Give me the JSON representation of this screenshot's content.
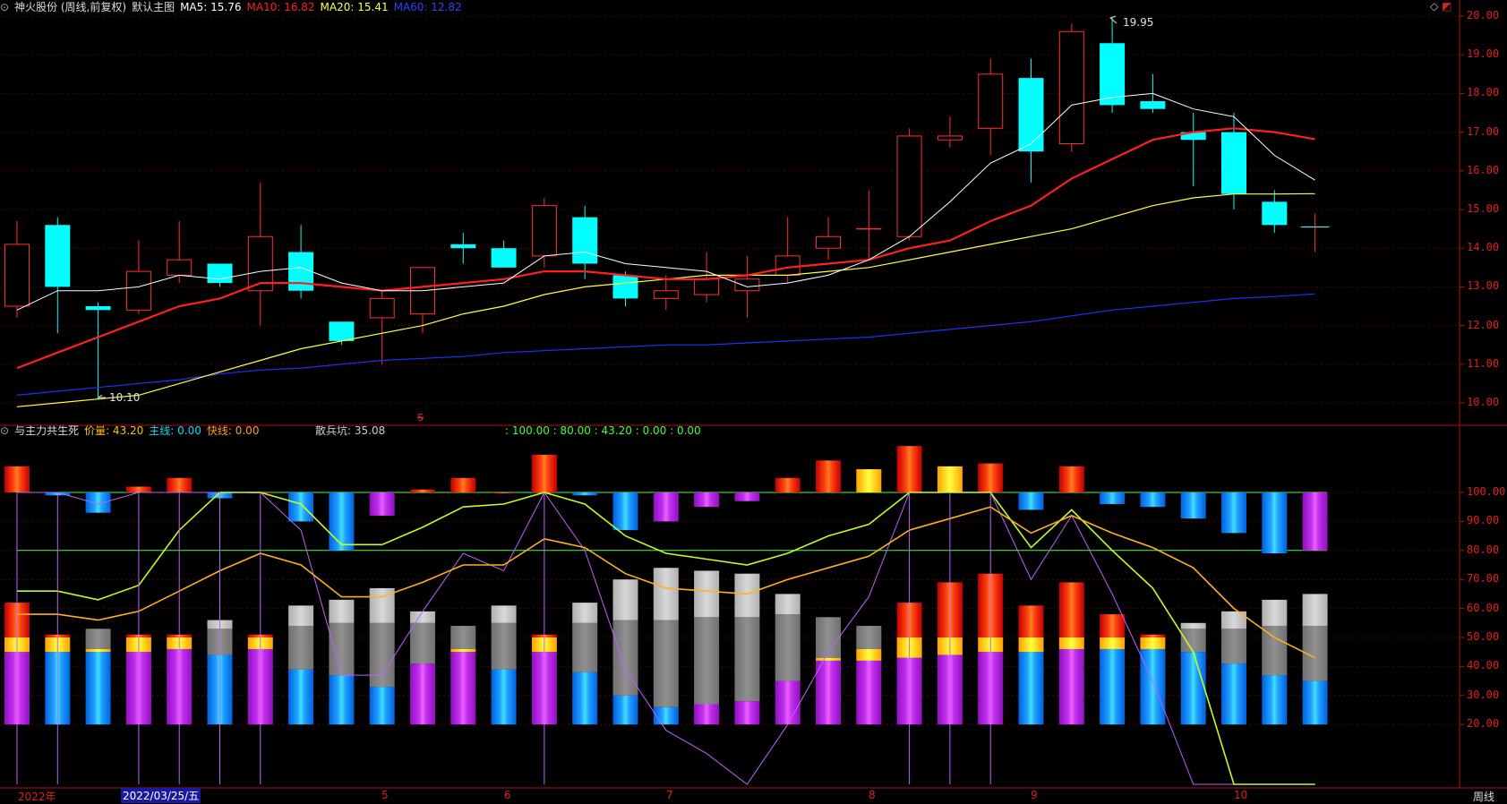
{
  "header": {
    "stock_title": "神火股份 (周线,前复权)",
    "indicator_menu": "默认主图",
    "ma5_label": "MA5: 15.76",
    "ma10_label": "MA10: 16.82",
    "ma20_label": "MA20: 15.41",
    "ma60_label": "MA60: 12.82",
    "ma5_color": "#ffffff",
    "ma10_color": "#ff2020",
    "ma20_color": "#ffff40",
    "ma60_color": "#2030ff"
  },
  "sub_header": {
    "indicator_name": "与主力共生死",
    "jialiang": "价量: 43.20",
    "zhuxian": "主线: 0.00",
    "kuaixian": "快线: 0.00",
    "sanbingkeng": "散兵坑: 35.08",
    "levels_text": ": 100.00 : 80.00 : 43.20 : 0.00 : 0.00"
  },
  "right_axis_main": [
    "20.00",
    "19.00",
    "18.00",
    "17.00",
    "16.00",
    "15.00",
    "14.00",
    "13.00",
    "12.00",
    "11.00",
    "10.00"
  ],
  "right_axis_sub": [
    "100.00",
    "90.00",
    "80.00",
    "70.00",
    "60.00",
    "50.00",
    "40.00",
    "30.00",
    "20.00"
  ],
  "annotations": {
    "high_mark": "19.95",
    "low_mark": "10.10",
    "s_marker": "S"
  },
  "time_axis": {
    "year_label": "2022年",
    "cursor_date": "2022/03/25/五",
    "months": [
      "5",
      "6",
      "7",
      "8",
      "9",
      "10"
    ],
    "period_label": "周线"
  },
  "colors": {
    "up": "#ff3030",
    "down": "#00ffff",
    "grid": "#5a0000",
    "frame": "#a01010"
  },
  "chart_data": {
    "type": "candlestick",
    "candles": [
      {
        "o": 12.5,
        "h": 14.7,
        "l": 12.2,
        "c": 14.1
      },
      {
        "o": 14.6,
        "h": 14.8,
        "l": 11.8,
        "c": 13.0
      },
      {
        "o": 12.5,
        "h": 12.6,
        "l": 10.1,
        "c": 12.4
      },
      {
        "o": 12.4,
        "h": 14.2,
        "l": 12.3,
        "c": 13.4
      },
      {
        "o": 13.3,
        "h": 14.7,
        "l": 13.1,
        "c": 13.7
      },
      {
        "o": 13.6,
        "h": 13.6,
        "l": 13.0,
        "c": 13.1
      },
      {
        "o": 12.9,
        "h": 15.7,
        "l": 12.0,
        "c": 14.3
      },
      {
        "o": 13.9,
        "h": 14.6,
        "l": 12.7,
        "c": 12.9
      },
      {
        "o": 12.1,
        "h": 12.1,
        "l": 11.5,
        "c": 11.6
      },
      {
        "o": 12.2,
        "h": 12.9,
        "l": 11.0,
        "c": 12.7
      },
      {
        "o": 12.3,
        "h": 13.5,
        "l": 11.8,
        "c": 13.5
      },
      {
        "o": 14.1,
        "h": 14.4,
        "l": 13.6,
        "c": 14.0
      },
      {
        "o": 14.0,
        "h": 14.2,
        "l": 13.5,
        "c": 13.5
      },
      {
        "o": 13.8,
        "h": 15.3,
        "l": 13.5,
        "c": 15.1
      },
      {
        "o": 14.8,
        "h": 15.1,
        "l": 13.2,
        "c": 13.6
      },
      {
        "o": 13.3,
        "h": 13.4,
        "l": 12.5,
        "c": 12.7
      },
      {
        "o": 12.7,
        "h": 13.3,
        "l": 12.4,
        "c": 12.9
      },
      {
        "o": 12.8,
        "h": 13.9,
        "l": 12.6,
        "c": 13.2
      },
      {
        "o": 12.9,
        "h": 13.8,
        "l": 12.2,
        "c": 13.2
      },
      {
        "o": 13.3,
        "h": 14.8,
        "l": 13.1,
        "c": 13.8
      },
      {
        "o": 14.0,
        "h": 14.8,
        "l": 13.7,
        "c": 14.3
      },
      {
        "o": 14.5,
        "h": 15.5,
        "l": 13.7,
        "c": 14.5
      },
      {
        "o": 14.3,
        "h": 17.1,
        "l": 14.2,
        "c": 16.9
      },
      {
        "o": 16.8,
        "h": 17.4,
        "l": 16.6,
        "c": 16.9
      },
      {
        "o": 17.1,
        "h": 18.9,
        "l": 16.4,
        "c": 18.5
      },
      {
        "o": 18.4,
        "h": 18.9,
        "l": 15.7,
        "c": 16.5
      },
      {
        "o": 16.7,
        "h": 19.8,
        "l": 16.5,
        "c": 19.6
      },
      {
        "o": 19.3,
        "h": 19.95,
        "l": 17.5,
        "c": 17.7
      },
      {
        "o": 17.8,
        "h": 18.5,
        "l": 17.5,
        "c": 17.6
      },
      {
        "o": 17.0,
        "h": 17.5,
        "l": 15.6,
        "c": 16.8
      },
      {
        "o": 17.0,
        "h": 17.5,
        "l": 15.0,
        "c": 15.4
      },
      {
        "o": 15.2,
        "h": 15.5,
        "l": 14.4,
        "c": 14.6
      },
      {
        "o": 14.55,
        "h": 14.9,
        "l": 13.9,
        "c": 14.55
      }
    ],
    "ma5": [
      12.4,
      12.9,
      12.9,
      13.0,
      13.3,
      13.2,
      13.4,
      13.5,
      13.1,
      12.9,
      12.9,
      13.0,
      13.1,
      13.8,
      13.9,
      13.6,
      13.5,
      13.4,
      13.0,
      13.1,
      13.3,
      13.7,
      14.3,
      15.2,
      16.2,
      16.7,
      17.7,
      17.9,
      18.0,
      17.6,
      17.4,
      16.4,
      15.76
    ],
    "ma10": [
      10.9,
      11.3,
      11.7,
      12.1,
      12.5,
      12.7,
      13.1,
      13.1,
      13.0,
      12.9,
      13.0,
      13.1,
      13.2,
      13.4,
      13.4,
      13.3,
      13.2,
      13.2,
      13.3,
      13.5,
      13.6,
      13.7,
      14.0,
      14.2,
      14.7,
      15.1,
      15.8,
      16.3,
      16.8,
      17.0,
      17.1,
      17.0,
      16.82
    ],
    "ma20": [
      9.9,
      10.0,
      10.1,
      10.2,
      10.5,
      10.8,
      11.1,
      11.4,
      11.6,
      11.8,
      12.0,
      12.3,
      12.5,
      12.8,
      13.0,
      13.1,
      13.2,
      13.3,
      13.3,
      13.3,
      13.4,
      13.5,
      13.7,
      13.9,
      14.1,
      14.3,
      14.5,
      14.8,
      15.1,
      15.3,
      15.4,
      15.4,
      15.41
    ],
    "ma60": [
      10.2,
      10.3,
      10.4,
      10.5,
      10.6,
      10.75,
      10.85,
      10.9,
      11.0,
      11.1,
      11.15,
      11.2,
      11.3,
      11.35,
      11.4,
      11.45,
      11.5,
      11.5,
      11.55,
      11.6,
      11.65,
      11.7,
      11.8,
      11.9,
      12.0,
      12.1,
      12.25,
      12.4,
      12.5,
      12.6,
      12.7,
      12.75,
      12.82
    ],
    "ylim": [
      9.7,
      20.2
    ],
    "sub": {
      "top_bars": [
        {
          "v": 109,
          "c": "red"
        },
        {
          "v": 99,
          "c": "blue"
        },
        {
          "v": 93,
          "c": "blue"
        },
        {
          "v": 102,
          "c": "red"
        },
        {
          "v": 105,
          "c": "red"
        },
        {
          "v": 98,
          "c": "blue"
        },
        {
          "v": 100,
          "c": "red"
        },
        {
          "v": 90,
          "c": "blue"
        },
        {
          "v": 80,
          "c": "blue"
        },
        {
          "v": 92,
          "c": "magenta"
        },
        {
          "v": 101,
          "c": "red"
        },
        {
          "v": 105,
          "c": "red"
        },
        {
          "v": 100,
          "c": "red"
        },
        {
          "v": 113,
          "c": "red"
        },
        {
          "v": 99,
          "c": "blue"
        },
        {
          "v": 87,
          "c": "blue"
        },
        {
          "v": 90,
          "c": "magenta"
        },
        {
          "v": 95,
          "c": "magenta"
        },
        {
          "v": 97,
          "c": "magenta"
        },
        {
          "v": 105,
          "c": "red"
        },
        {
          "v": 111,
          "c": "red"
        },
        {
          "v": 108,
          "c": "yellow"
        },
        {
          "v": 116,
          "c": "red"
        },
        {
          "v": 109,
          "c": "yellow"
        },
        {
          "v": 110,
          "c": "red"
        },
        {
          "v": 94,
          "c": "blue"
        },
        {
          "v": 109,
          "c": "red"
        },
        {
          "v": 96,
          "c": "blue"
        },
        {
          "v": 95,
          "c": "blue"
        },
        {
          "v": 91,
          "c": "blue"
        },
        {
          "v": 86,
          "c": "blue"
        },
        {
          "v": 79,
          "c": "blue"
        },
        {
          "v": 80,
          "c": "magenta"
        }
      ],
      "base_bars": [
        {
          "t": 45,
          "c": "magenta",
          "y": 50,
          "r": 62
        },
        {
          "t": 45,
          "c": "blue",
          "y": 50,
          "r": 51
        },
        {
          "t": 45,
          "c": "blue",
          "y": 46,
          "g": 53
        },
        {
          "t": 45,
          "c": "magenta",
          "y": 50,
          "r": 51
        },
        {
          "t": 46,
          "c": "magenta",
          "y": 50,
          "r": 51
        },
        {
          "t": 44,
          "c": "blue",
          "g": 53,
          "lg": 56
        },
        {
          "t": 46,
          "c": "magenta",
          "y": 50,
          "r": 51
        },
        {
          "t": 39,
          "c": "blue",
          "g": 54,
          "lg": 61
        },
        {
          "t": 37,
          "c": "blue",
          "g": 55,
          "lg": 63
        },
        {
          "t": 33,
          "c": "blue",
          "g": 55,
          "lg": 67
        },
        {
          "t": 41,
          "c": "magenta",
          "g": 55,
          "lg": 59
        },
        {
          "t": 45,
          "c": "magenta",
          "y": 46,
          "g": 54
        },
        {
          "t": 39,
          "c": "blue",
          "g": 55,
          "lg": 61
        },
        {
          "t": 45,
          "c": "magenta",
          "y": 50,
          "r": 51
        },
        {
          "t": 38,
          "c": "blue",
          "g": 55,
          "lg": 62
        },
        {
          "t": 30,
          "c": "blue",
          "g": 56,
          "lg": 70
        },
        {
          "t": 26,
          "c": "blue",
          "g": 56,
          "lg": 74
        },
        {
          "t": 27,
          "c": "magenta",
          "g": 57,
          "lg": 73
        },
        {
          "t": 28,
          "c": "magenta",
          "g": 57,
          "lg": 72
        },
        {
          "t": 35,
          "c": "magenta",
          "g": 58,
          "lg": 65
        },
        {
          "t": 42,
          "c": "magenta",
          "y": 43,
          "g": 57
        },
        {
          "t": 42,
          "c": "magenta",
          "y": 46,
          "g": 54
        },
        {
          "t": 43,
          "c": "magenta",
          "y": 50,
          "r": 62
        },
        {
          "t": 44,
          "c": "magenta",
          "y": 50,
          "r": 69
        },
        {
          "t": 45,
          "c": "magenta",
          "y": 50,
          "r": 72
        },
        {
          "t": 45,
          "c": "blue",
          "y": 50,
          "r": 61
        },
        {
          "t": 46,
          "c": "magenta",
          "y": 50,
          "r": 69
        },
        {
          "t": 46,
          "c": "blue",
          "y": 50,
          "r": 58
        },
        {
          "t": 46,
          "c": "blue",
          "y": 50,
          "r": 51
        },
        {
          "t": 45,
          "c": "blue",
          "g": 53,
          "lg": 55
        },
        {
          "t": 41,
          "c": "blue",
          "g": 53,
          "lg": 59
        },
        {
          "t": 37,
          "c": "blue",
          "g": 54,
          "lg": 63
        },
        {
          "t": 35,
          "c": "blue",
          "g": 54,
          "lg": 65
        }
      ],
      "line_green": [
        66,
        66,
        63,
        68,
        87,
        100,
        100,
        96,
        82,
        82,
        88,
        95,
        96,
        100,
        96,
        85,
        79,
        77,
        75,
        79,
        85,
        89,
        100,
        100,
        100,
        81,
        94,
        80,
        67,
        45,
        0,
        0,
        0
      ],
      "line_orange": [
        58,
        58,
        56,
        59,
        66,
        73,
        79,
        75,
        64,
        64,
        69,
        75,
        75,
        84,
        81,
        72,
        67,
        66,
        65,
        70,
        74,
        78,
        87,
        91,
        95,
        86,
        92,
        86,
        81,
        74,
        60,
        50,
        43
      ],
      "line_violet": [
        100,
        100,
        96,
        100,
        100,
        100,
        100,
        87,
        37,
        37,
        59,
        79,
        73,
        100,
        80,
        39,
        18,
        10,
        0,
        20,
        45,
        64,
        100,
        100,
        100,
        70,
        92,
        65,
        35,
        0,
        0,
        0,
        0
      ],
      "ylim": [
        0,
        120
      ]
    }
  }
}
